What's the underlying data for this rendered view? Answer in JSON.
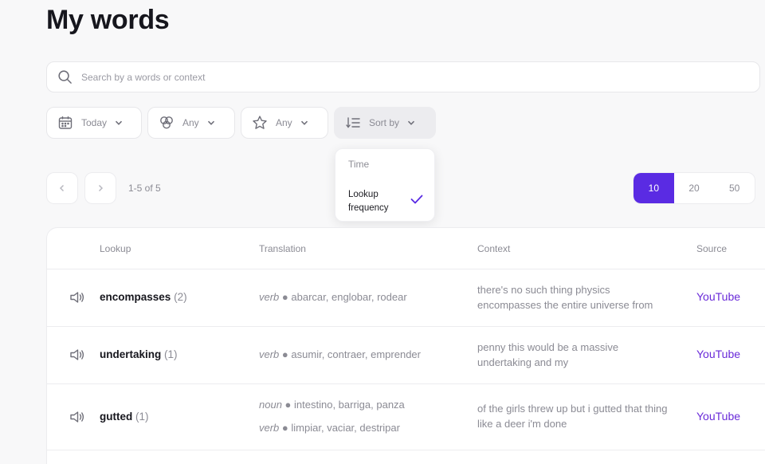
{
  "page": {
    "title": "My words"
  },
  "search": {
    "placeholder": "Search by a words or context",
    "value": ""
  },
  "filters": {
    "date": "Today",
    "category": "Any",
    "rating": "Any",
    "sort": "Sort by"
  },
  "sort_menu": {
    "options": [
      {
        "label": "Time",
        "selected": false
      },
      {
        "label": "Lookup frequency",
        "selected": true
      }
    ]
  },
  "pagination": {
    "info": "1-5 of 5",
    "page_sizes": [
      "10",
      "20",
      "50"
    ],
    "active_page_size": "10"
  },
  "table": {
    "headers": {
      "lookup": "Lookup",
      "translation": "Translation",
      "context": "Context",
      "source": "Source"
    },
    "rows": [
      {
        "word": "encompasses",
        "count": "(2)",
        "translations": [
          {
            "pos": "verb",
            "sep": "●",
            "meanings": "abarcar, englobar, rodear"
          }
        ],
        "context": "there's no such thing physics encompasses the entire universe from",
        "source": "YouTube"
      },
      {
        "word": "undertaking",
        "count": "(1)",
        "translations": [
          {
            "pos": "verb",
            "sep": "●",
            "meanings": "asumir, contraer, emprender"
          }
        ],
        "context": "penny this would be a massive undertaking and my",
        "source": "YouTube"
      },
      {
        "word": "gutted",
        "count": "(1)",
        "translations": [
          {
            "pos": "noun",
            "sep": "●",
            "meanings": "intestino, barriga, panza"
          },
          {
            "pos": "verb",
            "sep": "●",
            "meanings": "limpiar, vaciar, destripar"
          }
        ],
        "context": "of the girls threw up but i gutted that thing like a deer i'm done",
        "source": "YouTube"
      }
    ]
  },
  "colors": {
    "accent": "#5a2be3",
    "source_link": "#6a2bd9",
    "muted_text": "#8b8b94",
    "background": "#f8f8f9"
  }
}
